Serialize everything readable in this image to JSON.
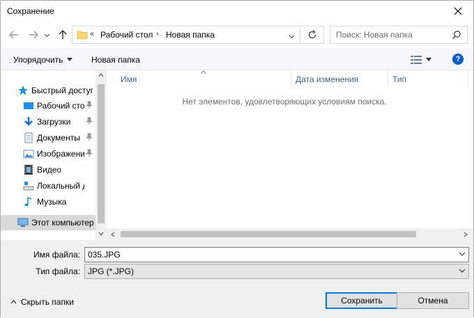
{
  "window": {
    "title": "Сохранение"
  },
  "address": {
    "overflow": "«",
    "segments": [
      "Рабочий стол",
      "Новая папка"
    ]
  },
  "search": {
    "placeholder": "Поиск: Новая папка"
  },
  "toolbar": {
    "organize": "Упорядочить",
    "new_folder": "Новая папка",
    "help": "?"
  },
  "sidebar": {
    "items": [
      {
        "label": "Быстрый доступ",
        "icon": "star-icon",
        "pinned": false
      },
      {
        "label": "Рабочий стол",
        "icon": "desktop-icon",
        "pinned": true
      },
      {
        "label": "Загрузки",
        "icon": "download-icon",
        "pinned": true
      },
      {
        "label": "Документы",
        "icon": "documents-icon",
        "pinned": true
      },
      {
        "label": "Изображения",
        "icon": "pictures-icon",
        "pinned": true
      },
      {
        "label": "Видео",
        "icon": "video-icon",
        "pinned": false
      },
      {
        "label": "Локальный диск",
        "icon": "drive-icon",
        "pinned": false
      },
      {
        "label": "Музыка",
        "icon": "music-icon",
        "pinned": false
      },
      {
        "label": "Этот компьютер",
        "icon": "computer-icon",
        "pinned": false
      }
    ]
  },
  "columns": [
    "Имя",
    "Дата изменения",
    "Тип"
  ],
  "empty_message": "Нет элементов, удовлетворяющих условиям поиска.",
  "form": {
    "filename_label": "Имя файла:",
    "filename_value": "035.JPG",
    "filetype_label": "Тип файла:",
    "filetype_value": "JPG (*.JPG)"
  },
  "footer": {
    "hide_folders": "Скрыть папки",
    "save": "Сохранить",
    "cancel": "Отмена"
  },
  "colors": {
    "accent": "#0078d7",
    "help": "#0a5ec8"
  }
}
